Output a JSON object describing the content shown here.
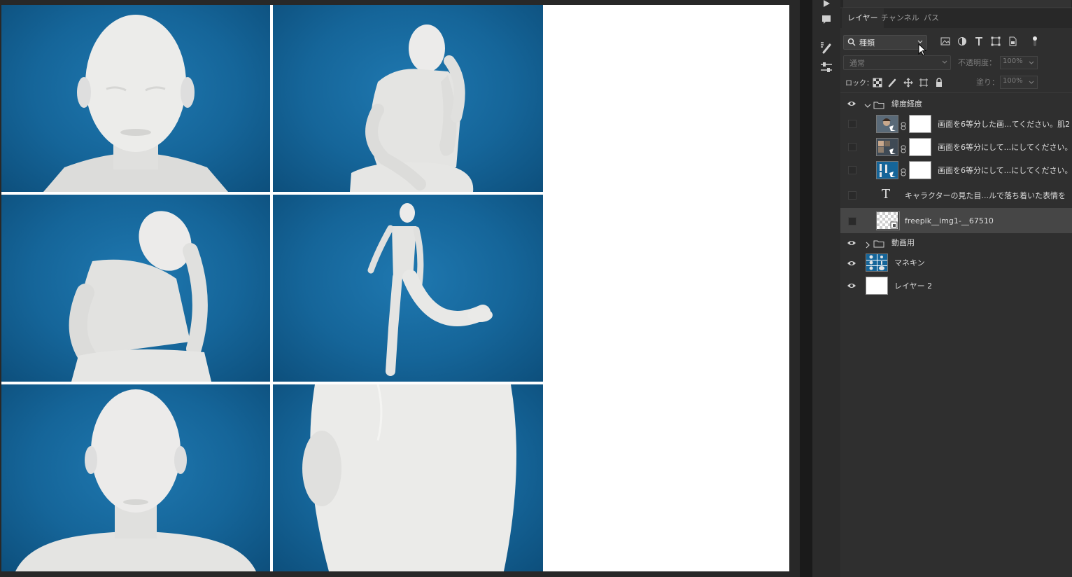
{
  "panel": {
    "tabs": [
      "レイヤー",
      "チャンネル",
      "パス"
    ],
    "filter": {
      "kind_label": "種類",
      "icon_names": [
        "image-filter-icon",
        "adjustment-filter-icon",
        "type-filter-icon",
        "shape-filter-icon",
        "smart-object-filter-icon",
        "filter-toggle-icon"
      ]
    },
    "blend": {
      "mode": "通常",
      "opacity_label": "不透明度：",
      "opacity_value": "100%"
    },
    "lock": {
      "label": "ロック：",
      "fill_label": "塗り：",
      "fill_value": "100%",
      "icon_names": [
        "lock-transparent-icon",
        "lock-paint-icon",
        "lock-move-icon",
        "lock-artboard-icon",
        "lock-all-icon"
      ]
    }
  },
  "layers": [
    {
      "type": "group",
      "name": "緯度経度",
      "visible": true,
      "expanded": true
    },
    {
      "type": "smart",
      "name": "画面を6等分した画...てください。肌2",
      "visible": false,
      "indent": true
    },
    {
      "type": "smart",
      "name": "画面を6等分にして...にしてください。",
      "visible": false,
      "indent": true
    },
    {
      "type": "smart",
      "name": "画面を6等分にして...にしてください。",
      "visible": false,
      "indent": true
    },
    {
      "type": "text",
      "name": "キャラクターの見た目...ルで落ち着いた表情を",
      "visible": false,
      "indent": true
    },
    {
      "type": "image",
      "name": "freepik__img1-__67510",
      "visible": false,
      "indent": true,
      "selected": true
    },
    {
      "type": "group",
      "name": "動画用",
      "visible": true,
      "expanded": false
    },
    {
      "type": "image",
      "name": "マネキン",
      "visible": true
    },
    {
      "type": "fill",
      "name": "レイヤー 2",
      "visible": true
    }
  ],
  "toolbar": {
    "icon_names": [
      "play-icon",
      "comment-icon",
      "brush-settings-icon",
      "adjustments-icon"
    ]
  },
  "canvas": {
    "background": "#ffffff",
    "photo_bg": "#156599",
    "mannequin": "#e8e8e6"
  }
}
